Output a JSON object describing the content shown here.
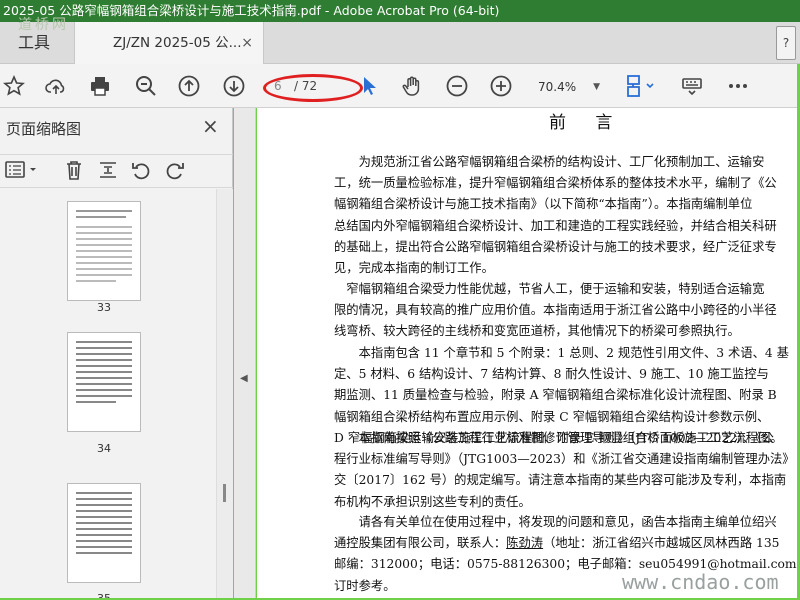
{
  "window": {
    "title": "2025-05 公路窄幅钢箱组合梁桥设计与施工技术指南.pdf - Adobe Acrobat Pro (64-bit)"
  },
  "tabs": {
    "tools_label": "工具",
    "doc_tab_label": "ZJ/ZN 2025-05 公...",
    "close": "×"
  },
  "toolbar": {
    "page_current": "6",
    "page_total": "/ 72",
    "zoom": "70.4%"
  },
  "panel": {
    "title": "页面缩略图",
    "close": "×",
    "thumbnails": [
      {
        "label": "33"
      },
      {
        "label": "34"
      },
      {
        "label": "35"
      }
    ]
  },
  "document": {
    "heading": "前  言",
    "paragraphs": [
      [
        "　　为规范浙江省公路窄幅钢箱组合梁桥的结构设计、工厂化预制加工、运输安",
        "工，统一质量检验标准，提升窄幅钢箱组合梁桥体系的整体技术水平，编制了《公",
        "幅钢箱组合梁桥设计与施工技术指南》（以下简称“本指南”）。本指南编制单位",
        "总结国内外窄幅钢箱组合梁桥设计、加工和建造的工程实践经验，并结合相关科研",
        "的基础上，提出符合公路窄幅钢箱组合梁桥设计与施工的技术要求，经广泛征求专",
        "见，完成本指南的制订工作。"
      ],
      [
        "　窄幅钢箱组合梁受力性能优越，节省人工，便于运输和安装，特别适合运输宽",
        "限的情况，具有较高的推广应用价值。本指南适用于浙江省公路中小跨径的小半径",
        "线弯桥、较大跨径的主线桥和变宽匝道桥，其他情况下的桥梁可参照执行。"
      ],
      [
        "　　本指南包含 11 个章节和 5 个附录：1 总则、2 规范性引用文件、3 术语、4 基",
        "定、5 材料、6 结构设计、7 结构计算、8 耐久性设计、9 施工、10 施工监控与",
        "期监测、11 质量检查与检验，附录 A 窄幅钢箱组合梁标准化设计流程图、附录 B",
        "幅钢箱组合梁桥结构布置应用示例、附录 C 窄幅钢箱组合梁结构设计参数示例、",
        "D 窄幅钢箱梁运输安装施工工艺流程图、附录 E 钢混组合桥面板施工工艺流程图。"
      ],
      [
        "　　本指南按照《公路工程行业标准制修订管理导则》（JTG 1002—2022）、《公",
        "程行业标准编写导则》（JTG1003—2023）和《浙江省交通建设指南编制管理办法》",
        "交〔2017〕162 号）的规定编写。请注意本指南的某些内容可能涉及专利，本指南",
        "布机构不承担识别这些专利的责任。"
      ]
    ],
    "para5_line1": "　　请各有关单位在使用过程中，将发现的问题和意见，函告本指南主编单位绍兴",
    "para5_line2_prefix": "通控股集团有限公司，联系人：",
    "contact_name": "陈劲涛",
    "para5_line2_suffix": "（地址：浙江省绍兴市越城区凤林西路 135",
    "para5_line3": "邮编：312000；电话：0575-88126300；电子邮箱：seu054991@hotmail.com），以",
    "para5_line4": "订时参考。"
  },
  "watermarks": {
    "top_left": "道桥网",
    "bottom_right": "www.cndao.com"
  }
}
